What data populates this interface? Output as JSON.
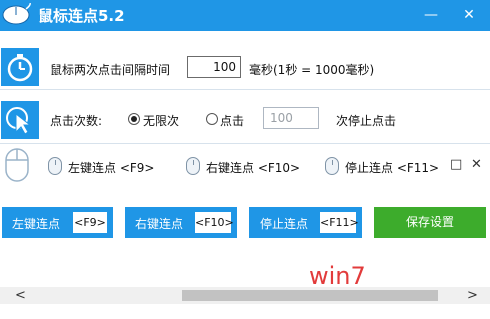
{
  "window": {
    "title": "鼠标连点5.2",
    "minimize_glyph": "—",
    "close_glyph": "✕"
  },
  "interval_row": {
    "label": "鼠标两次点击间隔时间",
    "value": "100",
    "unit": "毫秒(1秒 = 1000毫秒)"
  },
  "count_row": {
    "label": "点击次数:",
    "option_unlimited": "无限次",
    "option_click": "点击",
    "count_value": "100",
    "suffix": "次停止点击",
    "selected": "unlimited"
  },
  "hotkey_panel": {
    "items": [
      {
        "label": "左键连点 <F9>"
      },
      {
        "label": "右键连点 <F10>"
      },
      {
        "label": "停止连点 <F11>"
      }
    ],
    "restore_glyph": "□",
    "close_glyph": "✕"
  },
  "buttons": {
    "left_click": {
      "label": "左键连点",
      "key": "<F9>"
    },
    "right_click": {
      "label": "右键连点",
      "key": "<F10>"
    },
    "stop_click": {
      "label": "停止连点",
      "key": "<F11>"
    },
    "save": {
      "label": "保存设置"
    }
  },
  "watermark": "win7",
  "scrollbar": {
    "left_arrow": "<",
    "right_arrow": ">",
    "thumb_fraction": 0.3
  },
  "colors": {
    "accent": "#1f96e6",
    "save_green": "#3dac2c",
    "watermark_red": "#e23b3b"
  }
}
